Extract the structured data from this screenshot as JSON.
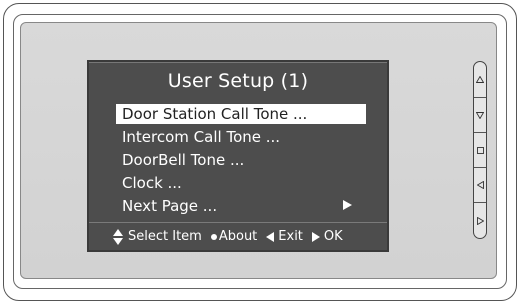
{
  "screen": {
    "title": "User Setup  (1)",
    "menu": [
      {
        "label": "Door Station Call Tone  ...",
        "selected": true
      },
      {
        "label": "Intercom Call Tone  ...",
        "selected": false
      },
      {
        "label": "DoorBell Tone  ...",
        "selected": false
      },
      {
        "label": "Clock  ...",
        "selected": false
      },
      {
        "label": "Next Page  ...",
        "selected": false,
        "has_arrow": true
      }
    ],
    "footer": {
      "select_label": "Select Item",
      "about_label": "About",
      "exit_label": "Exit",
      "ok_label": "OK"
    }
  },
  "keypad": {
    "keys": [
      {
        "name": "up",
        "icon": "triangle-up-icon"
      },
      {
        "name": "down",
        "icon": "triangle-down-icon"
      },
      {
        "name": "center",
        "icon": "square-icon"
      },
      {
        "name": "left",
        "icon": "triangle-left-icon"
      },
      {
        "name": "right",
        "icon": "triangle-right-icon"
      }
    ]
  },
  "colors": {
    "screen_bg": "#4d4d4d",
    "panel_bg": "#d6d6d6",
    "highlight_bg": "#ffffff",
    "text": "#ffffff"
  }
}
